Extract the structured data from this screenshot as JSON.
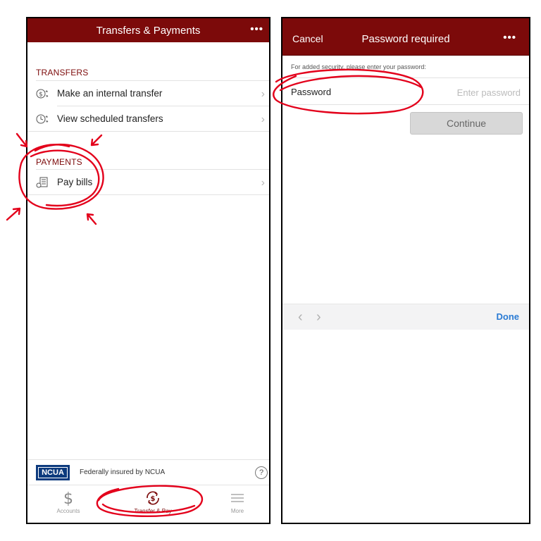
{
  "left_screen": {
    "title": "Transfers & Payments",
    "menu_icon": "more-dots-icon",
    "transfers_header": "TRANSFERS",
    "transfers": [
      {
        "label": "Make an internal transfer",
        "icon": "dollar-transfer-icon"
      },
      {
        "label": "View scheduled transfers",
        "icon": "clock-transfer-icon"
      }
    ],
    "payments_header": "PAYMENTS",
    "payments": [
      {
        "label": "Pay bills",
        "icon": "bill-pay-icon"
      }
    ],
    "ncua_logo": "NCUA",
    "ncua_text": "Federally insured by NCUA",
    "help_glyph": "?",
    "tabs": [
      {
        "label": "Accounts",
        "icon": "dollar-icon",
        "active": false
      },
      {
        "label": "Transfer & Pay",
        "icon": "transfer-pay-icon",
        "active": true
      },
      {
        "label": "More",
        "icon": "hamburger-menu-icon",
        "active": false
      }
    ]
  },
  "right_screen": {
    "cancel_label": "Cancel",
    "title": "Password required",
    "menu_icon": "more-dots-icon",
    "hint": "For added security, please enter your password:",
    "password_label": "Password",
    "password_value": "",
    "password_placeholder": "Enter password",
    "continue_label": "Continue",
    "keyboard_done_label": "Done"
  },
  "colors": {
    "brand": "#7c0a0a",
    "annotation": "#e3001b",
    "link": "#2a7bd4",
    "ncua": "#0c3a7d"
  }
}
